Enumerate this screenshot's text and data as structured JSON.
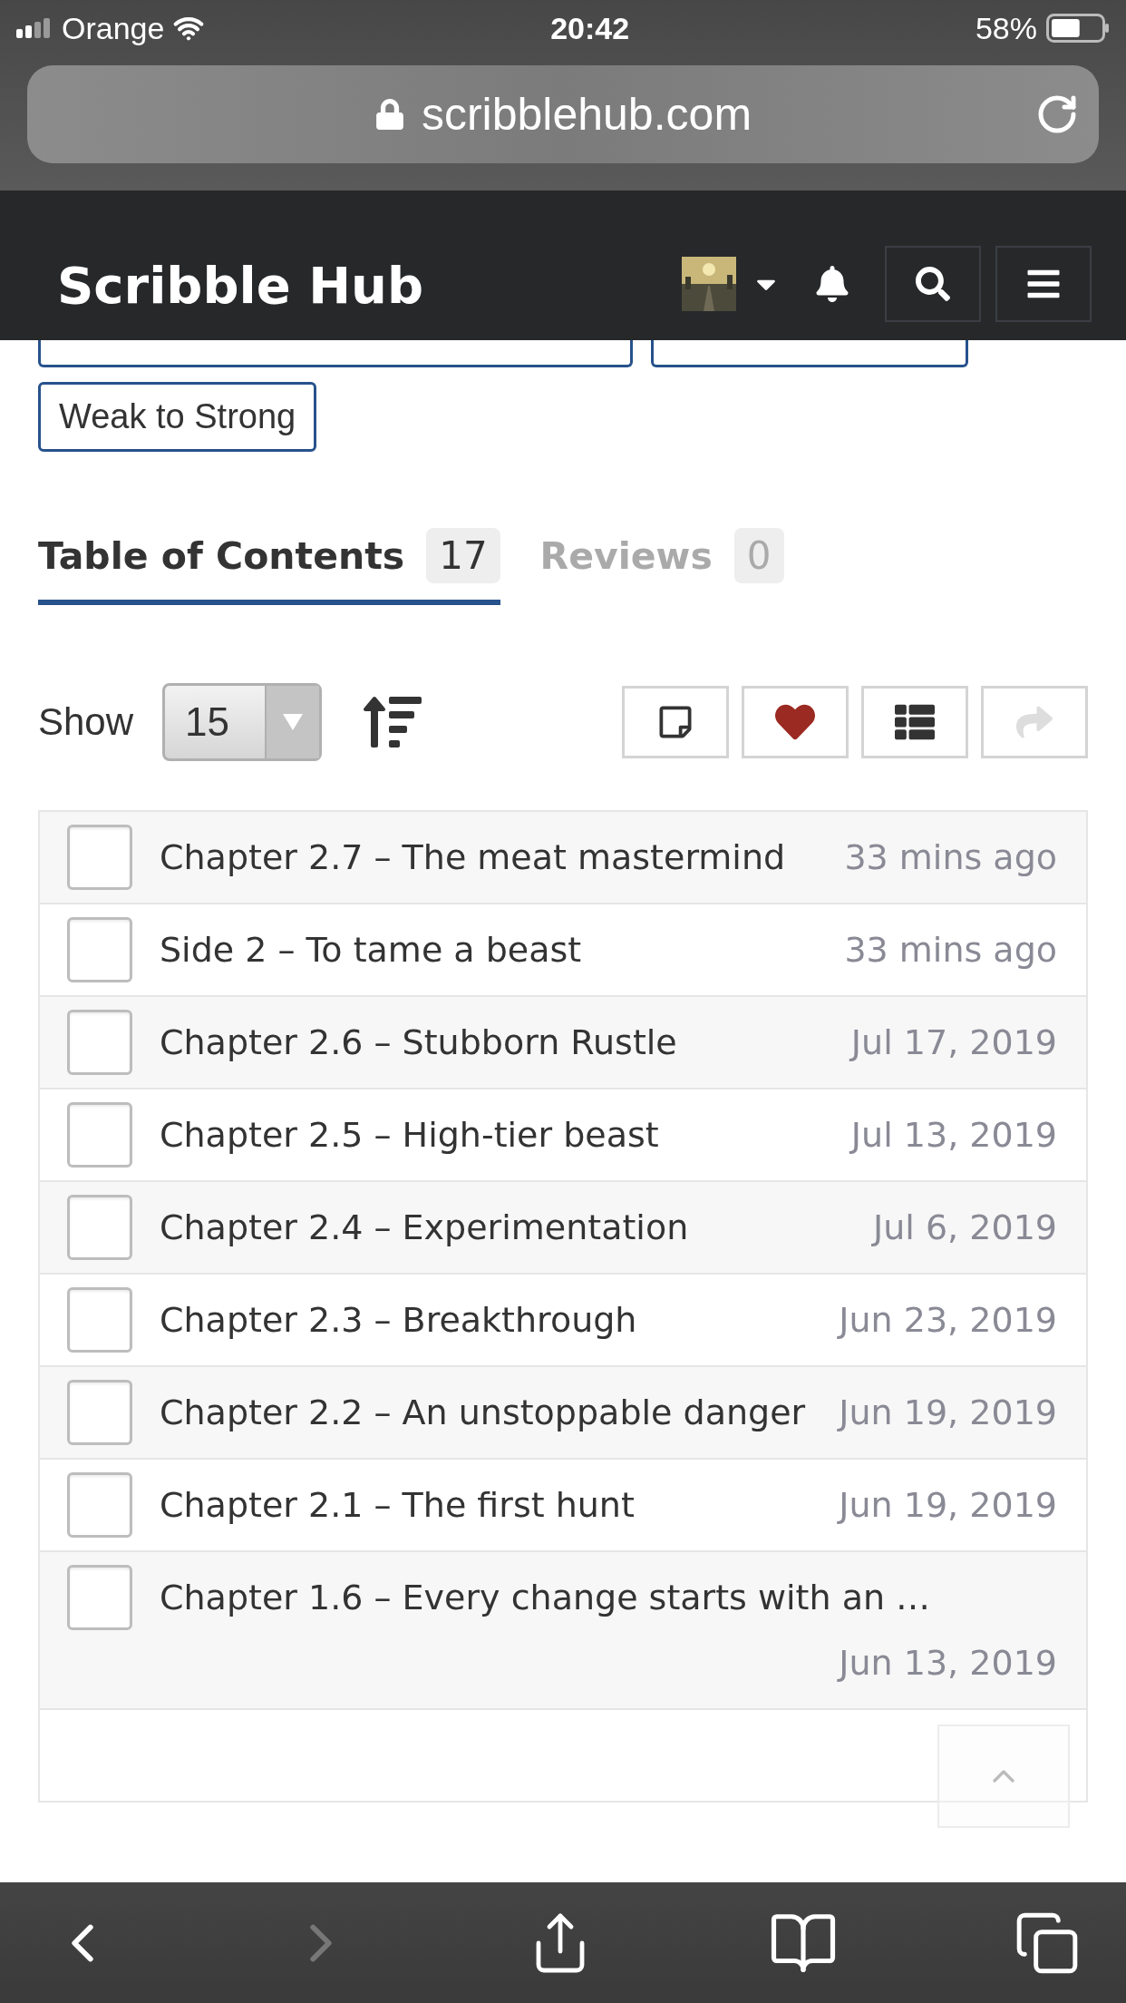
{
  "status_bar": {
    "carrier": "Orange",
    "time": "20:42",
    "battery": "58%"
  },
  "address_bar": {
    "url": "scribblehub.com"
  },
  "header": {
    "title": "Scribble Hub"
  },
  "tags": [
    "Weak to Strong"
  ],
  "tabs": [
    {
      "label": "Table of Contents",
      "count": "17",
      "selected": true
    },
    {
      "label": "Reviews",
      "count": "0",
      "selected": false
    }
  ],
  "toolbar": {
    "show_label": "Show",
    "page_size": "15",
    "actions": [
      {
        "kind": "note",
        "disabled": false
      },
      {
        "kind": "favorite",
        "disabled": false
      },
      {
        "kind": "list",
        "disabled": false
      },
      {
        "kind": "share",
        "disabled": true
      }
    ]
  },
  "chapters": [
    {
      "title": "Chapter 2.7 – The meat mastermind",
      "date": "33 mins ago",
      "checked": false
    },
    {
      "title": "Side 2 – To tame a beast",
      "date": "33 mins ago",
      "checked": false
    },
    {
      "title": "Chapter 2.6 – Stubborn Rustle",
      "date": "Jul 17, 2019",
      "checked": false
    },
    {
      "title": "Chapter 2.5 – High-tier beast",
      "date": "Jul 13, 2019",
      "checked": false
    },
    {
      "title": "Chapter 2.4 – Experimentation",
      "date": "Jul 6, 2019",
      "checked": false
    },
    {
      "title": "Chapter 2.3 – Breakthrough",
      "date": "Jun 23, 2019",
      "checked": false
    },
    {
      "title": "Chapter 2.2 – An unstoppable danger",
      "date": "Jun 19, 2019",
      "checked": false
    },
    {
      "title": "Chapter 2.1 – The first hunt",
      "date": "Jun 19, 2019",
      "checked": false
    },
    {
      "title": "Chapter 1.6 – Every change starts with an …",
      "date": "Jun 13, 2019",
      "checked": false
    }
  ]
}
